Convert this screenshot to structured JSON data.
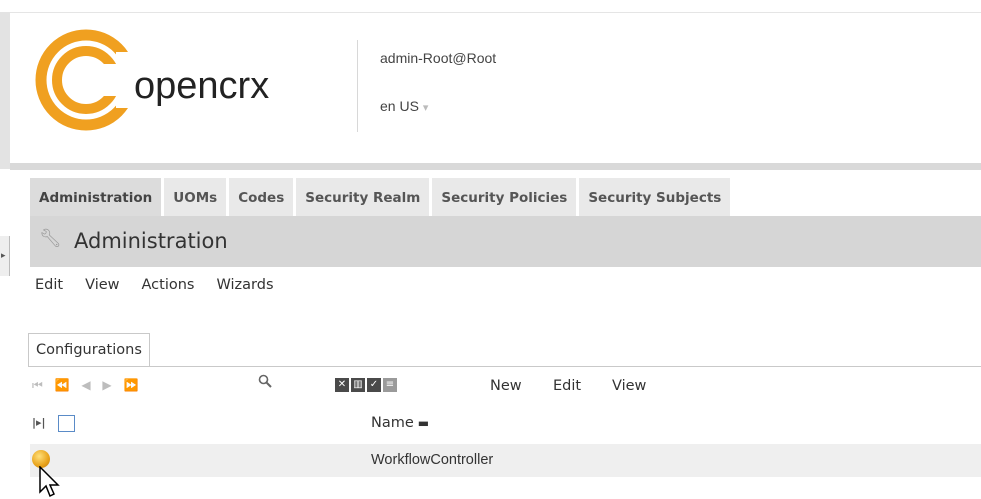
{
  "header": {
    "brand": "opencrx",
    "user": "admin-Root@Root",
    "locale": "en  US",
    "locale_arrow": "▾"
  },
  "tabs": [
    {
      "label": "Administration",
      "active": true
    },
    {
      "label": "UOMs"
    },
    {
      "label": "Codes"
    },
    {
      "label": "Security Realm"
    },
    {
      "label": "Security Policies"
    },
    {
      "label": "Security Subjects"
    }
  ],
  "page": {
    "title": "Administration",
    "title_icon": "wrench-icon"
  },
  "menu": [
    "Edit",
    "View",
    "Actions",
    "Wizards"
  ],
  "grid": {
    "tab_label": "Configurations",
    "pager_glyphs": "⏮ ⏪ ◀ ▶ ⏩",
    "toolbar": {
      "new": "New",
      "edit": "Edit",
      "view": "View"
    },
    "column_picker": "⇥",
    "columns": [
      {
        "label": "Name",
        "sort": "▬"
      }
    ],
    "rows": [
      {
        "name": "WorkflowController"
      }
    ]
  },
  "colors": {
    "accent_orange": "#f0a020",
    "titlebar_bg": "#d6d6d6",
    "row_bg": "#efefef"
  }
}
